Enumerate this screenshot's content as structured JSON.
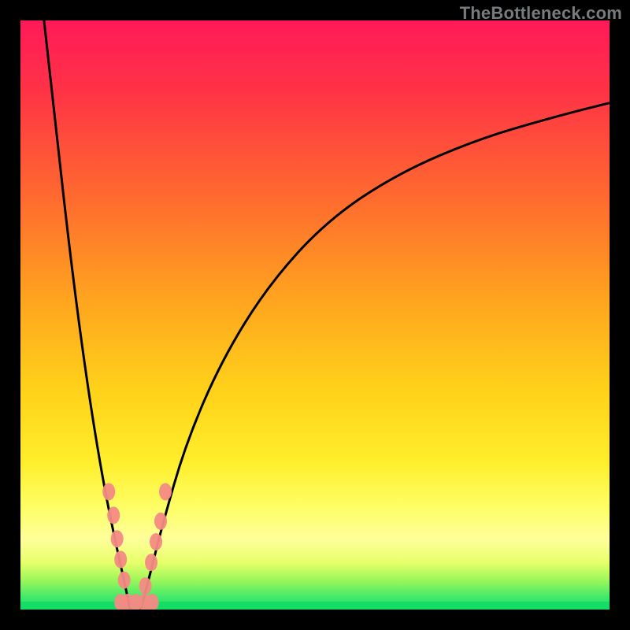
{
  "watermark": "TheBottleneck.com",
  "chart_data": {
    "type": "line",
    "title": "",
    "xlabel": "",
    "ylabel": "",
    "xlim": [
      0,
      100
    ],
    "ylim": [
      0,
      100
    ],
    "background_gradient": {
      "top": "#ff1a58",
      "upper": "#ff6a2f",
      "mid": "#ffd21a",
      "lower_band": "#ffff7a",
      "bottom": "#18e268"
    },
    "series": [
      {
        "name": "left-curve",
        "x": [
          4,
          6,
          8,
          10,
          12,
          14,
          16,
          17.8,
          18.6
        ],
        "y": [
          100,
          82,
          64,
          48,
          34,
          22,
          12,
          4,
          0
        ]
      },
      {
        "name": "right-curve",
        "x": [
          20.4,
          22,
          24,
          28,
          34,
          42,
          52,
          64,
          78,
          92,
          100
        ],
        "y": [
          0,
          6,
          14,
          28,
          42,
          55,
          66,
          74,
          80,
          84,
          86
        ]
      }
    ],
    "markers": {
      "name": "bead-cluster",
      "color": "#f48a84",
      "points": [
        {
          "x": 15.0,
          "y": 20.0
        },
        {
          "x": 15.8,
          "y": 16.0
        },
        {
          "x": 16.4,
          "y": 12.0
        },
        {
          "x": 17.0,
          "y": 8.5
        },
        {
          "x": 17.6,
          "y": 5.0
        },
        {
          "x": 17.0,
          "y": 1.2
        },
        {
          "x": 18.2,
          "y": 1.2
        },
        {
          "x": 19.6,
          "y": 1.2
        },
        {
          "x": 21.0,
          "y": 1.2
        },
        {
          "x": 22.4,
          "y": 1.2
        },
        {
          "x": 21.2,
          "y": 4.0
        },
        {
          "x": 22.2,
          "y": 8.0
        },
        {
          "x": 23.0,
          "y": 11.5
        },
        {
          "x": 23.8,
          "y": 15.0
        },
        {
          "x": 24.6,
          "y": 20.0
        }
      ]
    }
  }
}
